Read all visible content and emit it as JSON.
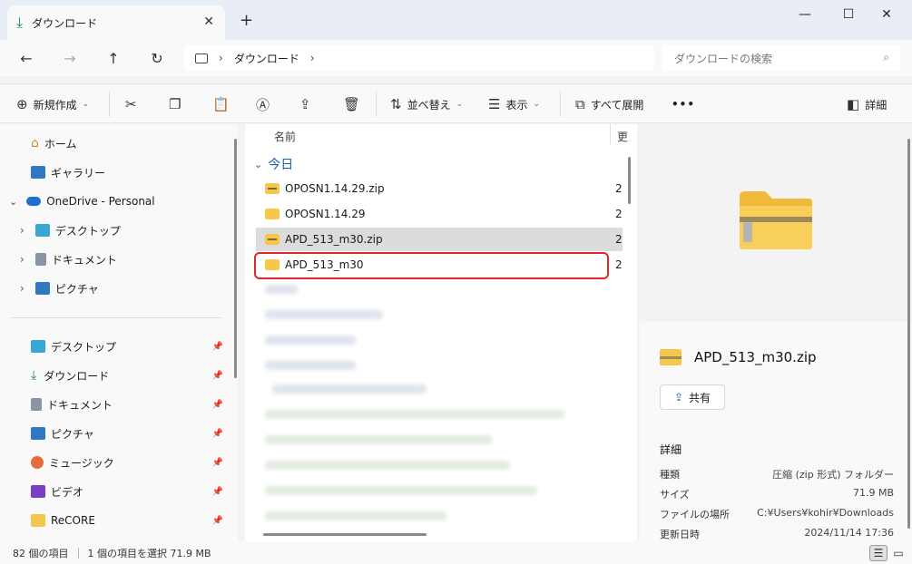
{
  "tab": {
    "title": "ダウンロード",
    "close": "✕",
    "new": "+"
  },
  "window": {
    "minimize": "—",
    "maximize": "☐",
    "close": "✕"
  },
  "nav": {
    "back": "←",
    "forward": "→",
    "up": "↑",
    "refresh": "↻"
  },
  "address": {
    "crumbs": [
      "ダウンロード"
    ],
    "sep": "›"
  },
  "search": {
    "placeholder": "ダウンロードの検索"
  },
  "toolbar": {
    "new_label": "新規作成",
    "sort_label": "並べ替え",
    "view_label": "表示",
    "expand_label": "すべて展開",
    "more_label": "•••",
    "details_label": "詳細"
  },
  "sidebar": {
    "top": [
      {
        "label": "ホーム"
      },
      {
        "label": "ギャラリー"
      },
      {
        "label": "OneDrive - Personal"
      },
      {
        "label": "デスクトップ"
      },
      {
        "label": "ドキュメント"
      },
      {
        "label": "ピクチャ"
      }
    ],
    "pinned": [
      {
        "label": "デスクトップ"
      },
      {
        "label": "ダウンロード"
      },
      {
        "label": "ドキュメント"
      },
      {
        "label": "ピクチャ"
      },
      {
        "label": "ミュージック"
      },
      {
        "label": "ビデオ"
      },
      {
        "label": "ReCORE"
      }
    ]
  },
  "list": {
    "col_name": "名前",
    "col_date": "更",
    "group": "今日",
    "files": [
      {
        "name": "OPOSN1.14.29.zip",
        "date": "2",
        "kind": "zip"
      },
      {
        "name": "OPOSN1.14.29",
        "date": "2",
        "kind": "folder"
      },
      {
        "name": "APD_513_m30.zip",
        "date": "2",
        "kind": "zip"
      },
      {
        "name": "APD_513_m30",
        "date": "2",
        "kind": "folder"
      }
    ]
  },
  "details": {
    "title": "APD_513_m30.zip",
    "share_label": "共有",
    "section": "詳細",
    "props": [
      {
        "k": "種類",
        "v": "圧縮 (zip 形式) フォルダー"
      },
      {
        "k": "サイズ",
        "v": "71.9 MB"
      },
      {
        "k": "ファイルの場所",
        "v": "C:¥Users¥kohir¥Downloads"
      },
      {
        "k": "更新日時",
        "v": "2024/11/14 17:36"
      }
    ]
  },
  "status": {
    "count": "82 個の項目",
    "selection": "1 個の項目を選択  71.9 MB"
  },
  "colors": {
    "accent": "#1b5fb4",
    "highlight": "#e0252b",
    "folder": "#f5c84c"
  }
}
